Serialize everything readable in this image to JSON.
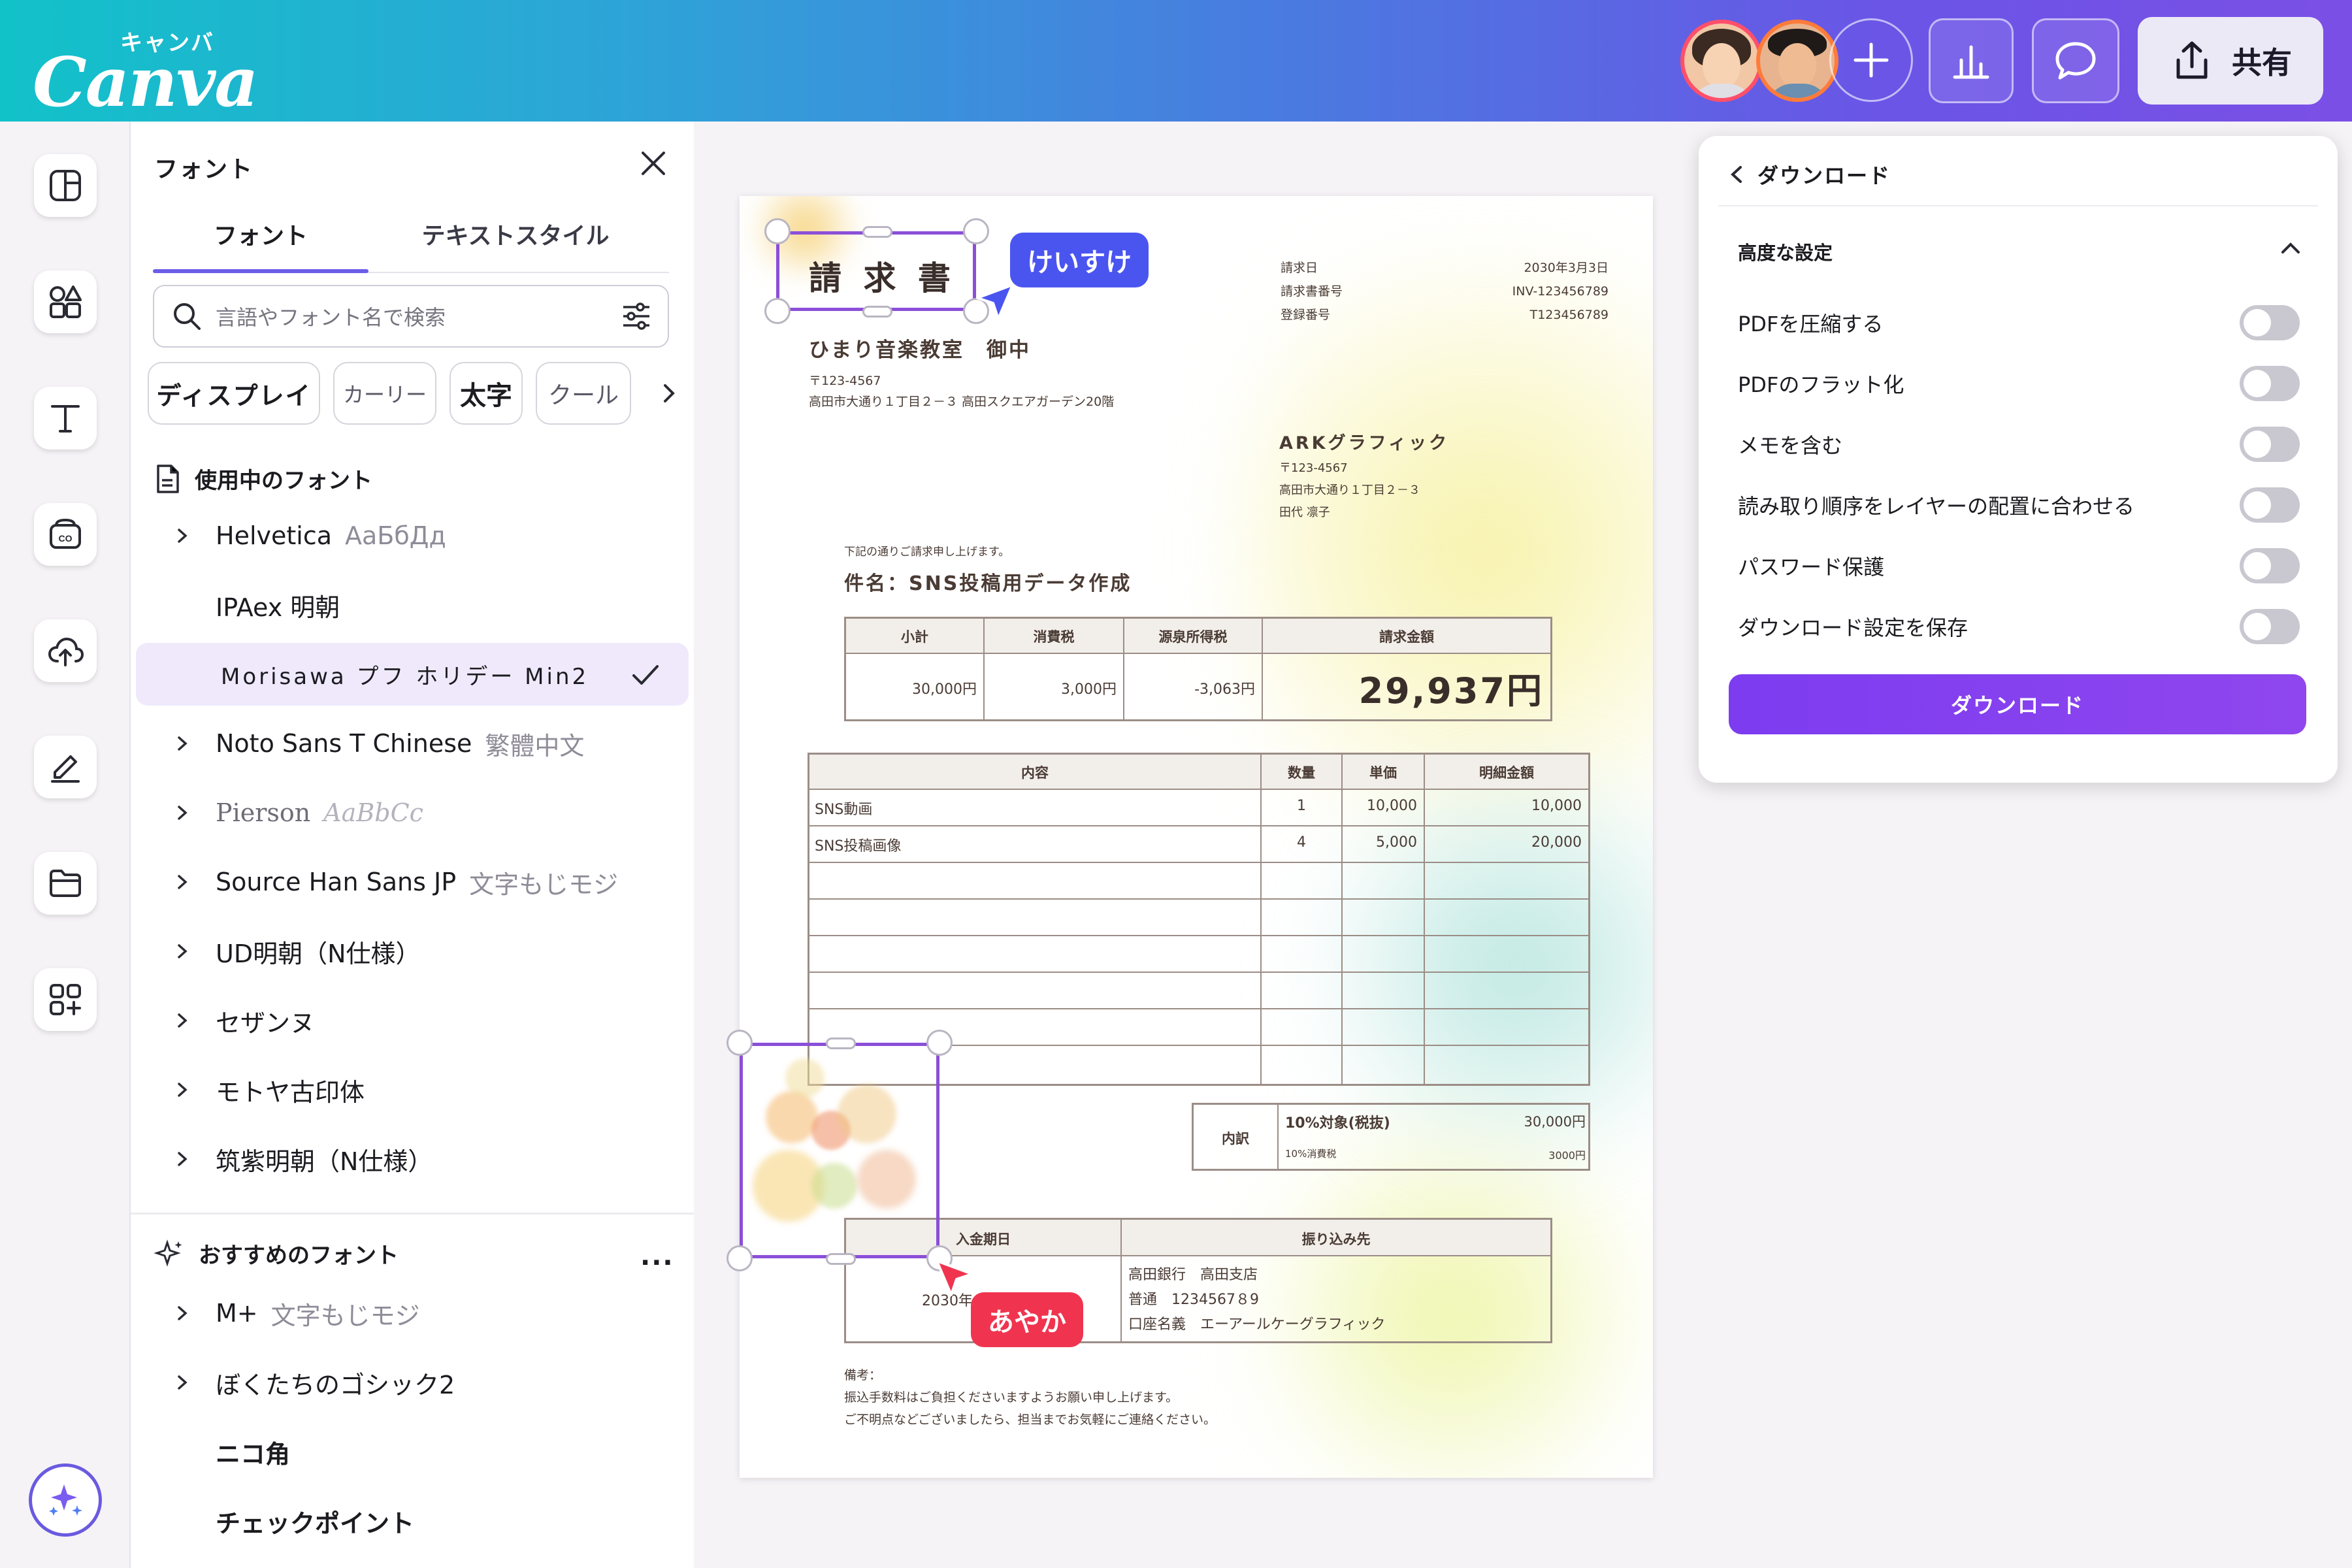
{
  "header": {
    "logo_kana": "キャンバ",
    "logo_word": "Canva",
    "share_label": "共有",
    "collaborators": [
      "avatar-1",
      "avatar-2"
    ],
    "buttons": [
      "plus-icon",
      "chart-icon",
      "comment-icon",
      "share-icon"
    ]
  },
  "rail": {
    "icons": [
      "design-icon",
      "elements-icon",
      "text-icon",
      "brand-icon",
      "uploads-icon",
      "draw-icon",
      "projects-icon",
      "apps-icon",
      "magic-icon"
    ]
  },
  "font_panel": {
    "title": "フォント",
    "tabs": [
      "フォント",
      "テキストスタイル"
    ],
    "search_placeholder": "言語やフォント名で検索",
    "chips": [
      "ディスプレイ",
      "カーリー",
      "太字",
      "クール"
    ],
    "in_use_title": "使用中のフォント",
    "in_use": [
      {
        "name": "Helvetica",
        "sample": "АаБбДд",
        "expandable": true
      },
      {
        "name": "IPAex 明朝",
        "sample": "",
        "expandable": false
      },
      {
        "name": "Morisawa プフ ホリデー Min2",
        "sample": "",
        "expandable": false,
        "selected": true
      },
      {
        "name": "Noto Sans T Chinese",
        "sample": "繁體中文",
        "expandable": true
      },
      {
        "name": "Pierson",
        "sample": "AaBbCc",
        "expandable": true
      },
      {
        "name": "Source Han Sans JP",
        "sample": "文字もじモジ",
        "expandable": true
      },
      {
        "name": "UD明朝（N仕様）",
        "sample": "",
        "expandable": true
      },
      {
        "name": "セザンヌ",
        "sample": "",
        "expandable": true
      },
      {
        "name": "モトヤ古印体",
        "sample": "",
        "expandable": true
      },
      {
        "name": "筑紫明朝（N仕様）",
        "sample": "",
        "expandable": true
      }
    ],
    "recommended_title": "おすすめのフォント",
    "more": "...",
    "recommended": [
      {
        "name": "M+",
        "sample": "文字もじモジ",
        "expandable": true
      },
      {
        "name": "ぼくたちのゴシック2",
        "sample": "",
        "expandable": true
      },
      {
        "name": "ニコ角",
        "sample": "",
        "expandable": false
      },
      {
        "name": "チェックポイント",
        "sample": "",
        "expandable": false
      }
    ]
  },
  "document": {
    "title": "請 求 書",
    "client": "ひまり音楽教室　御中",
    "client_postal": "〒123-4567",
    "client_address": "高田市大通り１丁目２－３ 高田スクエアガーデン20階",
    "meta_labels": [
      "請求日",
      "請求書番号",
      "登録番号"
    ],
    "meta_values": [
      "2030年3月3日",
      "INV-123456789",
      "T123456789"
    ],
    "issuer_name": "ARKグラフィック",
    "issuer_postal": "〒123-4567",
    "issuer_address": "高田市大通り１丁目２－３",
    "issuer_person": "田代 凛子",
    "note_line": "下記の通りご請求申し上げます。",
    "subject": "件名：SNS投稿用データ作成",
    "summary_headers": [
      "小計",
      "消費税",
      "源泉所得税",
      "請求金額"
    ],
    "summary_values": [
      "30,000円",
      "3,000円",
      "-3,063円",
      "29,937円"
    ],
    "items_headers": [
      "内容",
      "数量",
      "単価",
      "明細金額"
    ],
    "items": [
      [
        "SNS動画",
        "1",
        "10,000",
        "10,000"
      ],
      [
        "SNS投稿画像",
        "4",
        "5,000",
        "20,000"
      ]
    ],
    "breakdown_label": "内訳",
    "breakdown_rows": [
      [
        "10%対象(税抜)",
        "30,000円"
      ],
      [
        "10%消費税",
        "3000円"
      ]
    ],
    "pay_headers": [
      "入金期日",
      "振り込み先"
    ],
    "pay_date": "2030年",
    "bank_lines": [
      "高田銀行　高田支店",
      "普通　1234567８9",
      "口座名義　エーアールケーグラフィック"
    ],
    "remarks_title": "備考：",
    "remarks": [
      "振込手数料はご負担くださいますようお願い申し上げます。",
      "ご不明点などございましたら、担当までお気軽にご連絡ください。"
    ],
    "collaborator_tags": [
      "けいすけ",
      "あやか"
    ],
    "tag_colors": [
      "#4a55f0",
      "#f0344f"
    ]
  },
  "download_panel": {
    "title": "ダウンロード",
    "section": "高度な設定",
    "options": [
      "PDFを圧縮する",
      "PDFのフラット化",
      "メモを含む",
      "読み取り順序をレイヤーの配置に合わせる",
      "パスワード保護",
      "ダウンロード設定を保存"
    ],
    "toggles": [
      false,
      false,
      false,
      false,
      false,
      false
    ],
    "button": "ダウンロード"
  },
  "colors": {
    "accent": "#6c5ce7",
    "download_button": "#7d3cf0",
    "selection": "#8b4fd8"
  }
}
